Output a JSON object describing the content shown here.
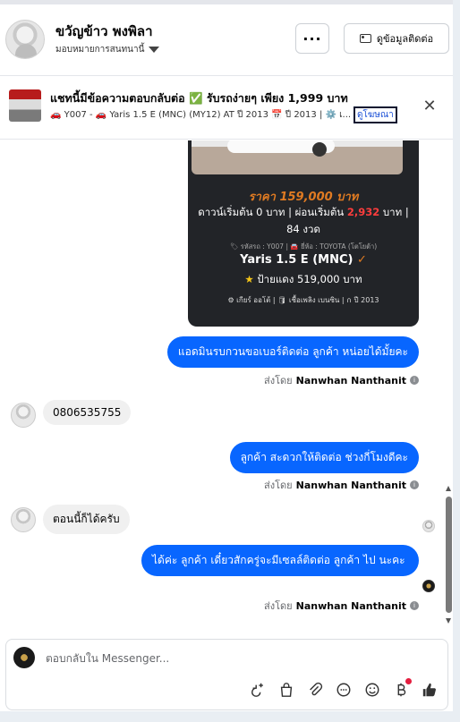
{
  "header": {
    "name": "ขวัญข้าว พงพิลา",
    "assign_label": "มอบหมายการสนทนานี้",
    "more_label": "···",
    "contact_button": "ดูข้อมูลติดต่อ"
  },
  "ad_banner": {
    "title": "แชทนี้มีข้อความตอบกลับต่อ ✅ รับรถง่ายๆ เพียง 1,999 บาท",
    "subtitle": "🚗 Y007 - 🚗 Yaris 1.5 E (MNC) (MY12) AT ปี 2013 📅 ปี 2013 | ⚙️ เ...",
    "link": "ดูโฆษณา",
    "close": "✕"
  },
  "listing_card": {
    "price": "ราคา 159,000 บาท",
    "terms_prefix": "ดาวน์เริ่มต้น 0 บาท | ผ่อนเริ่มต้น ",
    "installment": "2,932",
    "terms_suffix": " บาท | 84 งวด",
    "meta": "🏷 รหัสรถ : Y007 | 🚘 ยี่ห้อ : TOYOTA (โตโยต้า)",
    "model": "Yaris 1.5 E (MNC)",
    "model_check": "✓",
    "plate": "ป้ายแดง 519,000 บาท",
    "specs": "⚙ เกียร์ ออโต้  |  🛢 เชื้อเพลิง เบนซิน  |  ∩ ปี 2013"
  },
  "messages": [
    {
      "side": "out",
      "text": "แอดมินรบกวนขอเบอร์ติดต่อ ลูกค้า หน่อยได้มั้ยคะ"
    },
    {
      "side": "in",
      "text": "0806535755"
    },
    {
      "side": "out",
      "text": "ลูกค้า สะดวกให้ติดต่อ ช่วงกี่โมงดีคะ"
    },
    {
      "side": "in",
      "text": "ตอนนี้ก็ได้ครับ"
    },
    {
      "side": "out",
      "text": "ได้ค่ะ  ลูกค้า  เดี๋ยวสักครู่จะมีเซลล์ติดต่อ ลูกค้า ไป นะคะ"
    }
  ],
  "sent_by": {
    "prefix": "ส่งโดย",
    "name": "Nanwhan Nanthanit"
  },
  "composer": {
    "placeholder": "ตอบกลับใน Messenger..."
  },
  "colors": {
    "accent": "#0866ff",
    "price": "#e07b22",
    "installment": "#ff3d3d",
    "card": "#222428"
  }
}
